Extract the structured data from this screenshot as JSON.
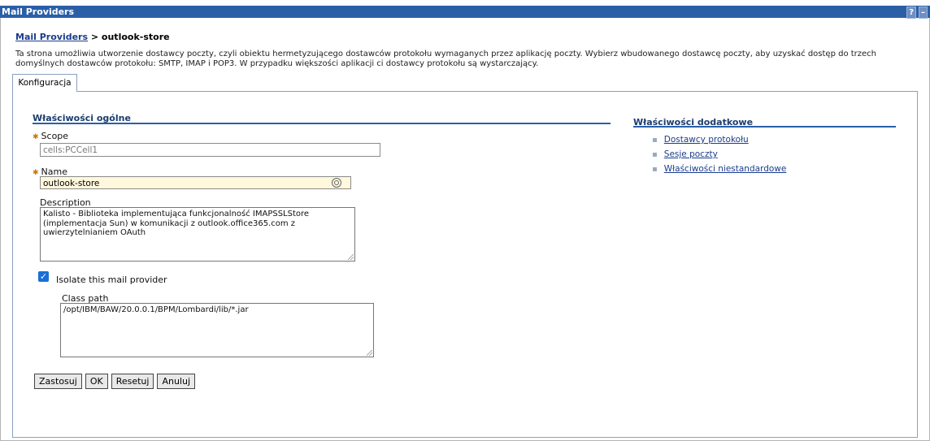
{
  "window": {
    "title": "Mail Providers",
    "help_label": "?",
    "minimize_label": "–"
  },
  "breadcrumb": {
    "link": "Mail Providers",
    "separator": " > ",
    "current": "outlook-store"
  },
  "description": "Ta strona umożliwia utworzenie dostawcy poczty, czyli obiektu hermetyzującego dostawców protokołu wymaganych przez aplikację poczty. Wybierz wbudowanego dostawcę poczty, aby uzyskać dostęp do trzech domyślnych dostawców protokołu: SMTP, IMAP i POP3. W przypadku większości aplikacji ci dostawcy protokołu są wystarczający.",
  "tabs": [
    {
      "label": "Konfiguracja"
    }
  ],
  "general": {
    "title": "Właściwości ogólne",
    "scope_label": "Scope",
    "scope_value": "cells:PCCell1",
    "name_label": "Name",
    "name_value": "outlook-store",
    "description_label": "Description",
    "description_value": "Kalisto - Biblioteka implementująca funkcjonalność IMAPSSLStore (implementacja Sun) w komunikacji z outlook.office365.com z uwierzytelnianiem OAuth",
    "isolate_label": "Isolate this mail provider",
    "isolate_checked": true,
    "classpath_label": "Class path",
    "classpath_value": "/opt/IBM/BAW/20.0.0.1/BPM/Lombardi/lib/*.jar"
  },
  "buttons": {
    "apply": "Zastosuj",
    "ok": "OK",
    "reset": "Resetuj",
    "cancel": "Anuluj"
  },
  "additional": {
    "title": "Właściwości dodatkowe",
    "links": [
      "Dostawcy protokołu",
      "Sesje poczty",
      "Właściwości niestandardowe"
    ]
  }
}
